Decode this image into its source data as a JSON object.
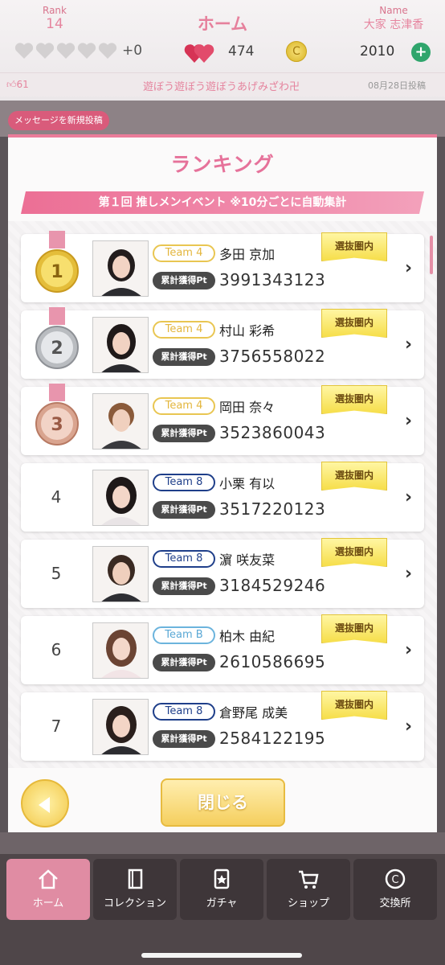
{
  "header": {
    "rank_label": "Rank",
    "rank_value": "14",
    "title": "ホーム",
    "name_label": "Name",
    "name_value": "大家 志津香",
    "hearts_extra": "+0",
    "love_count": "474",
    "coin_count": "2010",
    "coin_symbol": "C"
  },
  "ticker": {
    "likes": "61",
    "text": "遊ぼう遊ぼう遊ぼうあげみざわ卍",
    "date": "08月28日投稿"
  },
  "new_post_button": "メッセージを新規投稿",
  "modal": {
    "title": "ランキング",
    "banner": "第１回 推しメンイベント ※10分ごとに自動集計",
    "points_label": "累計獲得Pt",
    "badge_label": "選抜圏内",
    "close_label": "閉じる"
  },
  "ranking": [
    {
      "rank": "1",
      "team": "Team 4",
      "team_color": "#e3b63e",
      "name": "多田 京加",
      "points": "3991343123"
    },
    {
      "rank": "2",
      "team": "Team 4",
      "team_color": "#e3b63e",
      "name": "村山 彩希",
      "points": "3756558022"
    },
    {
      "rank": "3",
      "team": "Team 4",
      "team_color": "#e3b63e",
      "name": "岡田 奈々",
      "points": "3523860043"
    },
    {
      "rank": "4",
      "team": "Team 8",
      "team_color": "#1f3f8a",
      "name": "小栗 有以",
      "points": "3517220123"
    },
    {
      "rank": "5",
      "team": "Team 8",
      "team_color": "#1f3f8a",
      "name": "濵 咲友菜",
      "points": "3184529246"
    },
    {
      "rank": "6",
      "team": "Team B",
      "team_color": "#5aa8d5",
      "name": "柏木 由紀",
      "points": "2610586695"
    },
    {
      "rank": "7",
      "team": "Team 8",
      "team_color": "#1f3f8a",
      "name": "倉野尾 成美",
      "points": "2584122195"
    }
  ],
  "nav": [
    {
      "label": "ホーム",
      "icon": "home-icon",
      "active": true
    },
    {
      "label": "コレクション",
      "icon": "collection-icon",
      "active": false
    },
    {
      "label": "ガチャ",
      "icon": "gacha-icon",
      "active": false
    },
    {
      "label": "ショップ",
      "icon": "cart-icon",
      "active": false
    },
    {
      "label": "交換所",
      "icon": "exchange-icon",
      "active": false
    }
  ]
}
